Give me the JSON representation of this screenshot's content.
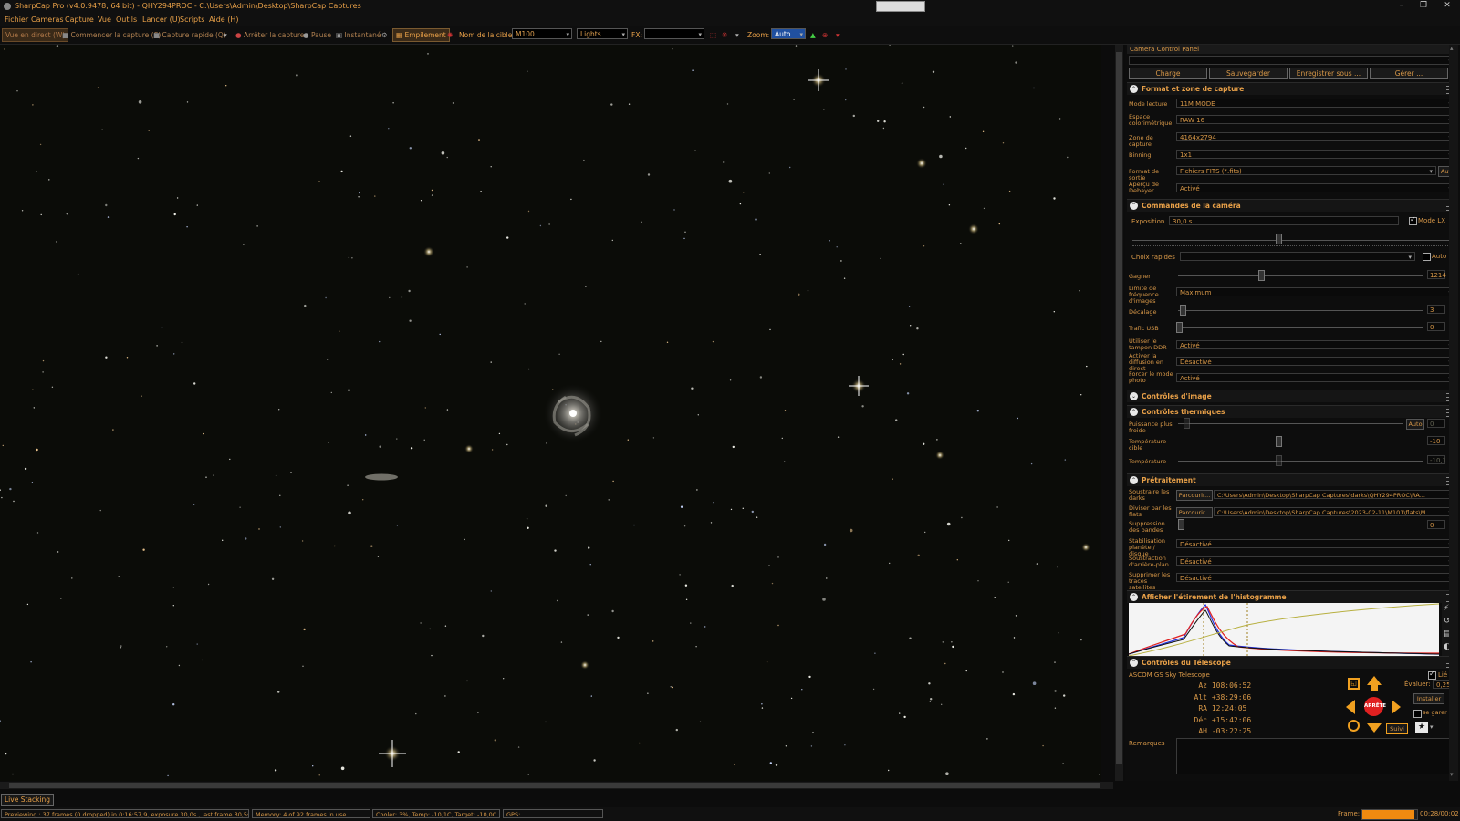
{
  "window": {
    "title": "SharpCap Pro (v4.0.9478, 64 bit) - QHY294PROC - C:\\Users\\Admin\\Desktop\\SharpCap Captures"
  },
  "menu": [
    "Fichier",
    "Cameras",
    "Capture",
    "Vue",
    "Outils",
    "Lancer (U)",
    "Scripts",
    "Aide (H)"
  ],
  "toolbar": {
    "live_view": "Vue en direct (W)",
    "start_capture": "Commencer la capture (S)",
    "quick_capture": "Capture rapide (Q)",
    "stop_capture": "Arrêter la capture",
    "pause": "Pause",
    "snapshot": "Instantané",
    "stacking": "Empilement",
    "target_label": "Nom de la cible:",
    "target_value": "M100",
    "frame_type": "Lights",
    "fx_label": "FX:",
    "fx_value": "",
    "zoom_label": "Zoom:",
    "zoom_value": "Auto"
  },
  "panel": {
    "title": "Camera Control Panel",
    "buttons": {
      "load": "Charge",
      "save": "Sauvegarder",
      "save_as": "Enregistrer sous ...",
      "manage": "Gérer ..."
    },
    "capture_section": {
      "header": "Format et zone de capture",
      "rows": [
        {
          "label": "Mode lecture",
          "value": "11M MODE"
        },
        {
          "label": "Espace colorimétrique",
          "value": "RAW 16"
        },
        {
          "label": "Zone de capture",
          "value": "4164x2794"
        },
        {
          "label": "Binning",
          "value": "1x1"
        },
        {
          "label": "Format de sortie",
          "value": "Fichiers FITS (*.fits)",
          "extra": "Auto"
        },
        {
          "label": "Aperçu de Debayer",
          "value": "Activé"
        }
      ]
    },
    "camera_section": {
      "header": "Commandes de la caméra",
      "exposure_label": "Exposition",
      "exposure_value": "30,0 s",
      "lx_mode_label": "Mode LX",
      "quick_choices_label": "Choix rapides",
      "auto_label": "Auto",
      "gain_label": "Gagner",
      "gain_value": "1214",
      "framerate_label": "Limite de fréquence d'images",
      "framerate_value": "Maximum",
      "offset_label": "Décalage",
      "offset_value": "3",
      "usb_label": "Trafic USB",
      "usb_value": "0",
      "ddr_label": "Utiliser le tampon DDR",
      "ddr_value": "Activé",
      "live_label": "Activer la diffusion en direct",
      "live_value": "Désactivé",
      "photo_label": "Forcer le mode photo",
      "photo_value": "Activé"
    },
    "image_controls_header": "Contrôles d'image",
    "thermal_section": {
      "header": "Contrôles thermiques",
      "power_label": "Puissance plus froide",
      "power_auto": "Auto",
      "power_value": "0",
      "target_label": "Température cible",
      "target_value": "-10",
      "temp_label": "Température",
      "temp_value": "-10,1"
    },
    "preprocessing_section": {
      "header": "Prétraitement",
      "darks_label": "Soustraire les darks",
      "darks_browse": "Parcourir...",
      "darks_path": "C:\\Users\\Admin\\Desktop\\SharpCap Captures\\darks\\QHY294PROC\\RA...",
      "flats_label": "Diviser par les flats",
      "flats_browse": "Parcourir...",
      "flats_path": "C:\\Users\\Admin\\Desktop\\SharpCap Captures\\2023-02-11\\M101\\flats\\M...",
      "banding_label": "Suppression des bandes",
      "banding_value": "0",
      "stab_label": "Stabilisation planète / disque",
      "stab_value": "Désactivé",
      "bg_label": "Soustraction d'arrière-plan",
      "bg_value": "Désactivé",
      "sat_label": "Supprimer les traces satellites",
      "sat_value": "Désactivé"
    },
    "histogram_header": "Afficher l'étirement de l'histogramme",
    "telescope_section": {
      "header": "Contrôles du Télescope",
      "name": "ASCOM GS Sky Telescope",
      "linked_label": "Lié",
      "coords": [
        {
          "k": "Az",
          "v": "108:06:52"
        },
        {
          "k": "Alt",
          "v": "+38:29:06"
        },
        {
          "k": "RA",
          "v": "12:24:05"
        },
        {
          "k": "Déc",
          "v": "+15:42:06"
        },
        {
          "k": "AH",
          "v": "-03:22:25"
        }
      ],
      "rate_label": "Évaluer:",
      "rate_value": "0,25",
      "install": "Installer",
      "park": "se garer",
      "stop": "ARRÊTE",
      "track": "Suivi"
    },
    "remarks_label": "Remarques"
  },
  "live_stacking_tab": "Live Stacking",
  "status": {
    "preview": "Previewing : 37 frames (0 dropped) in 0:16:57,9, exposure 30,0s , last frame 30,5s",
    "memory": "Memory: 4 of 92 frames in use.",
    "cooler": "Cooler: 3%, Temp: -10,1C, Target: -10,0C",
    "gps": "GPS:",
    "frame_label": "Frame:",
    "frame_time": "00:28/00:02",
    "frame_progress": 0.95
  },
  "colors": {
    "accent": "#e8a048",
    "stop_red": "#e02020",
    "arrow_orange": "#f0a020"
  }
}
